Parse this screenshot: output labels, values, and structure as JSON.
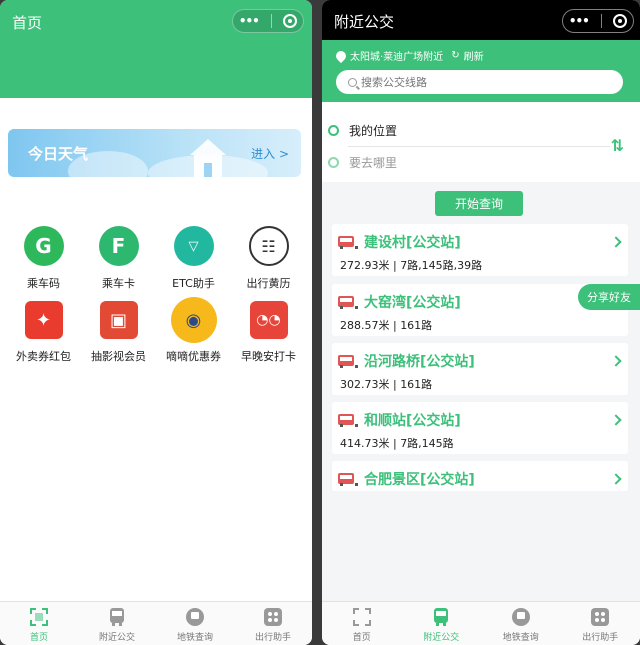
{
  "left": {
    "title": "首页",
    "weather": {
      "title": "今日天气",
      "enter": "进入 >"
    },
    "icons": [
      {
        "label": "乘车码",
        "icon": "ride-code-icon"
      },
      {
        "label": "乘车卡",
        "icon": "ride-card-icon"
      },
      {
        "label": "ETC助手",
        "icon": "etc-icon"
      },
      {
        "label": "出行黄历",
        "icon": "almanac-icon"
      },
      {
        "label": "外卖券红包",
        "icon": "takeout-coupon-icon"
      },
      {
        "label": "抽影视会员",
        "icon": "gift-icon"
      },
      {
        "label": "嘀嘀优惠券",
        "icon": "taxi-icon"
      },
      {
        "label": "早晚安打卡",
        "icon": "checkin-icon"
      }
    ],
    "tabs": [
      {
        "label": "首页",
        "active": true
      },
      {
        "label": "附近公交",
        "active": false
      },
      {
        "label": "地铁查询",
        "active": false
      },
      {
        "label": "出行助手",
        "active": false
      }
    ]
  },
  "right": {
    "title": "附近公交",
    "location": "太阳城·莱迪广场附近",
    "refresh": "刷新",
    "search_placeholder": "搜索公交线路",
    "from": "我的位置",
    "to_placeholder": "要去哪里",
    "query_button": "开始查询",
    "stations": [
      {
        "name": "建设村[公交站]",
        "info": "272.93米 | 7路,145路,39路"
      },
      {
        "name": "大窑湾[公交站]",
        "info": "288.57米 | 161路"
      },
      {
        "name": "沿河路桥[公交站]",
        "info": "302.73米 | 161路"
      },
      {
        "name": "和顺站[公交站]",
        "info": "414.73米 | 7路,145路"
      },
      {
        "name": "合肥景区[公交站]",
        "info": ""
      }
    ],
    "share": "分享好友",
    "tabs": [
      {
        "label": "首页",
        "active": false
      },
      {
        "label": "附近公交",
        "active": true
      },
      {
        "label": "地铁查询",
        "active": false
      },
      {
        "label": "出行助手",
        "active": false
      }
    ]
  },
  "colors": {
    "brand_green": "#3cc07a",
    "bus_red": "#e25555"
  }
}
